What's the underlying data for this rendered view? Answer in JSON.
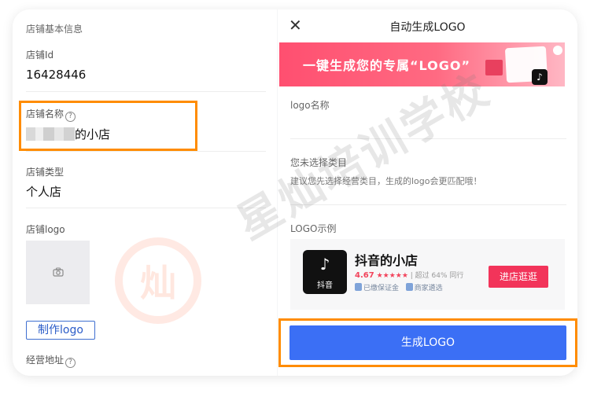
{
  "left": {
    "section_title": "店铺基本信息",
    "store_id_label": "店铺Id",
    "store_id_value": "16428446",
    "store_name_label": "店铺名称",
    "store_name_suffix": "的小店",
    "store_type_label": "店铺类型",
    "store_type_value": "个人店",
    "store_logo_label": "店铺logo",
    "make_logo_button": "制作logo",
    "address_label": "经营地址",
    "help_glyph": "?"
  },
  "modal": {
    "close_glyph": "✕",
    "title": "自动生成LOGO",
    "banner_text": "一键生成您的专属“LOGO”",
    "logo_name_label": "logo名称",
    "category_label": "您未选择类目",
    "category_hint": "建议您先选择经营类目，生成的logo会更匹配哦！",
    "example_label": "LOGO示例",
    "example_shop": {
      "logo_caption": "抖音",
      "name": "抖音的小店",
      "score": "4.67",
      "stars": "★★★★★",
      "beat_text": "| 超过 64% 同行",
      "tag_deposit": "已缴保证金",
      "tag_select": "商家遴选",
      "visit_button": "进店逛逛"
    },
    "generate_button": "生成LOGO"
  },
  "watermark": {
    "text": "星灿培训学校",
    "glyph": "灿"
  },
  "colors": {
    "highlight": "#ff8c00",
    "primary": "#3b6ff5",
    "accent": "#f2345a"
  }
}
